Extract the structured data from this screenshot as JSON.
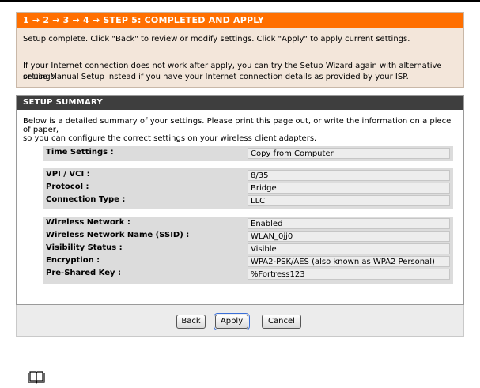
{
  "step": {
    "header": "1 → 2 → 3 → 4 → STEP 5: COMPLETED AND APPLY",
    "line1": "Setup complete. Click \"Back\" to review or modify settings. Click \"Apply\" to apply current settings.",
    "line2": "If your Internet connection does not work after apply, you can try the Setup Wizard again with alternative settings",
    "line3": "or use Manual Setup instead if you have your Internet connection details as provided by your ISP."
  },
  "summary": {
    "header": "SETUP SUMMARY",
    "desc1": "Below is a detailed summary of your settings. Please print this page out, or write the information on a piece of paper,",
    "desc2": "so you can configure the correct settings on your wireless client adapters.",
    "time_group": [
      {
        "label": "Time Settings :",
        "value": "Copy from Computer"
      }
    ],
    "wan_group": [
      {
        "label": "VPI / VCI :",
        "value": "8/35"
      },
      {
        "label": "Protocol :",
        "value": "Bridge"
      },
      {
        "label": "Connection Type :",
        "value": "LLC"
      }
    ],
    "wireless_group": [
      {
        "label": "Wireless Network :",
        "value": "Enabled"
      },
      {
        "label": "Wireless Network Name (SSID) :",
        "value": "WLAN_0jj0"
      },
      {
        "label": "Visibility Status :",
        "value": "Visible"
      },
      {
        "label": "Encryption :",
        "value": "WPA2-PSK/AES (also known as WPA2 Personal)"
      },
      {
        "label": "Pre-Shared Key :",
        "value": "%Fortress123"
      }
    ]
  },
  "buttons": {
    "back": "Back",
    "apply": "Apply",
    "cancel": "Cancel"
  },
  "colors": {
    "step_header": "#ff6f00",
    "step_panel": "#f3e6da",
    "summary_header": "#3e3e3e"
  },
  "icons": {
    "note": "book-icon"
  }
}
